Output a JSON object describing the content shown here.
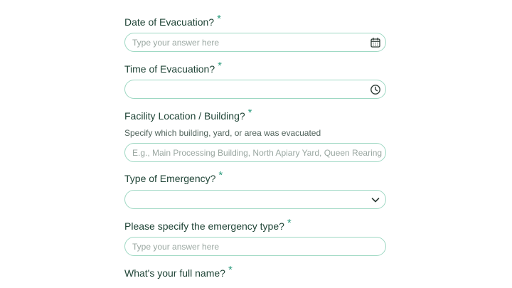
{
  "form": {
    "date": {
      "label": "Date of Evacuation?",
      "required": "*",
      "placeholder": "Type your answer here",
      "value": ""
    },
    "time": {
      "label": "Time of Evacuation?",
      "required": "*",
      "placeholder": "",
      "value": ""
    },
    "facility": {
      "label": "Facility Location / Building?",
      "required": "*",
      "help": "Specify which building, yard, or area was evacuated",
      "placeholder": "E.g., Main Processing Building, North Apiary Yard, Queen Rearing Facility",
      "value": ""
    },
    "emergency_type": {
      "label": "Type of Emergency?",
      "required": "*",
      "selected": ""
    },
    "emergency_specify": {
      "label": "Please specify the emergency type?",
      "required": "*",
      "placeholder": "Type your answer here",
      "value": ""
    },
    "full_name": {
      "label": "What's your full name?",
      "required": "*"
    }
  },
  "icons": {
    "date": "calendar-icon",
    "time": "clock-icon",
    "emergency_type": "chevron-down-icon"
  },
  "colors": {
    "label": "#1f4436",
    "required": "#2f9d7f",
    "field_border": "#9ed8c3",
    "placeholder": "#9aa7a1",
    "icon": "#2d3b35"
  }
}
